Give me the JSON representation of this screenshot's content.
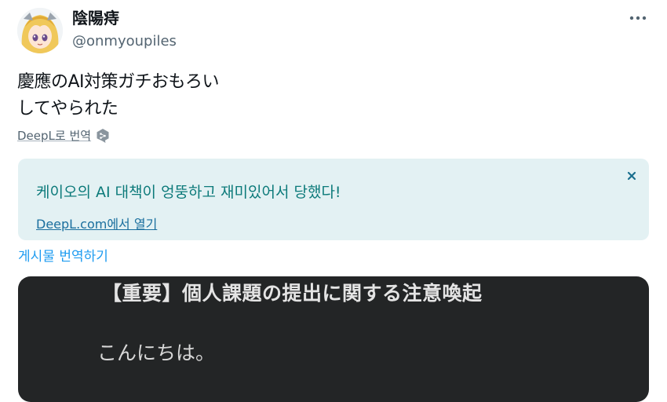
{
  "post": {
    "author": {
      "display_name": "陰陽痔",
      "handle": "@onmyoupiles",
      "avatar_icon": "anime-character-avatar"
    },
    "more_icon": "more-options-icon",
    "text_lines": [
      "慶應のAI対策ガチおもろい",
      "してやられた"
    ],
    "deepl_translate_label": "DeepL로 번역",
    "translation": {
      "text": "케이오의 AI 대책이 엉뚱하고 재미있어서 당했다!",
      "open_link": "DeepL.com에서 열기",
      "close_icon": "close-icon"
    },
    "translate_post_label": "게시물 번역하기",
    "media": {
      "title": "【重要】個人課題の提出に関する注意喚起",
      "body": "こんにちは。"
    }
  },
  "colors": {
    "translation_bg": "#e3f1f3",
    "translation_text": "#0c7a7a",
    "link_blue": "#1d9bf0",
    "media_bg": "#232526"
  }
}
